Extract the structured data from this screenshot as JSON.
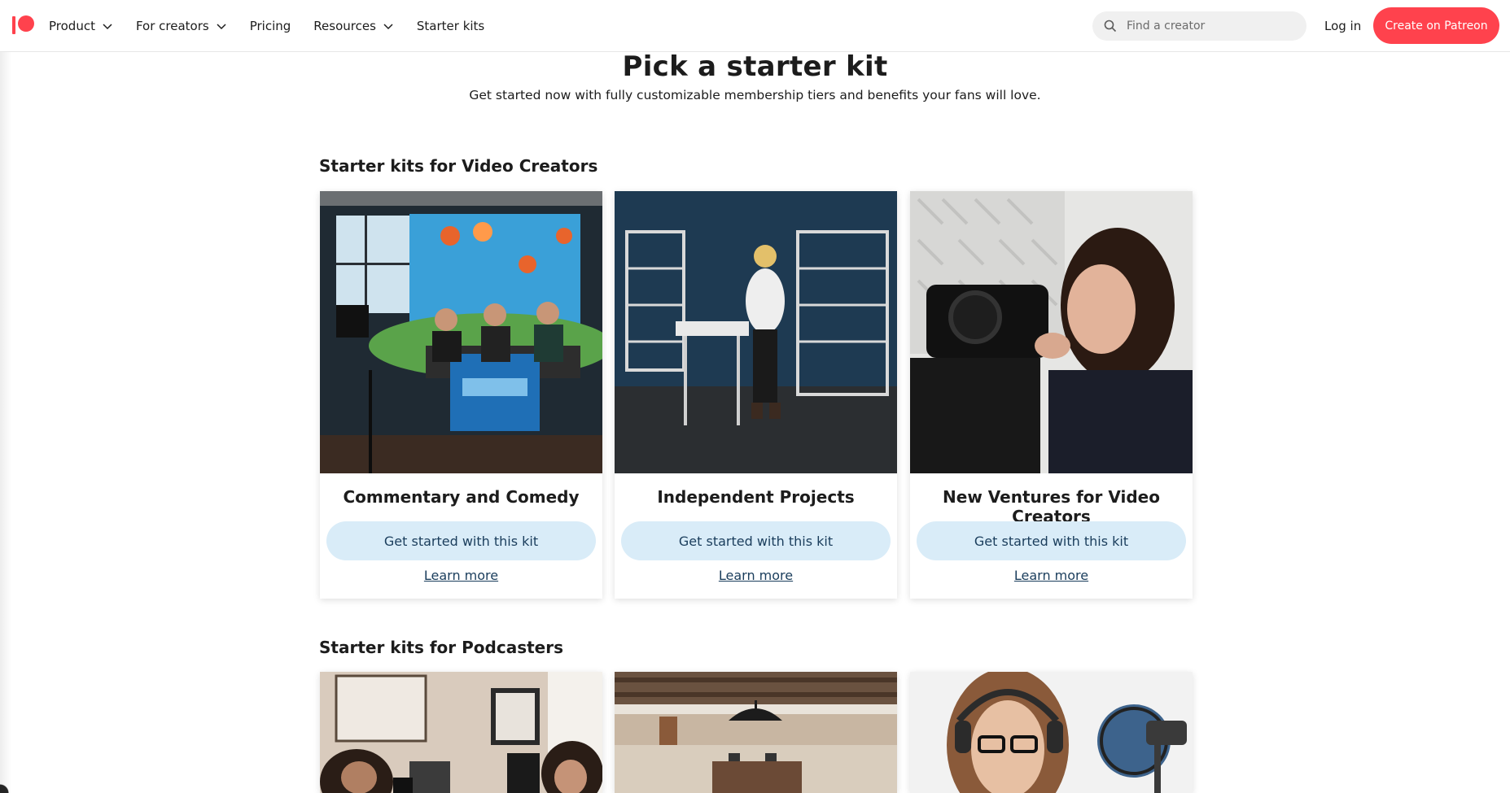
{
  "header": {
    "logo_name": "patreon-logo",
    "nav": [
      {
        "label": "Product",
        "dropdown": true
      },
      {
        "label": "For creators",
        "dropdown": true
      },
      {
        "label": "Pricing",
        "dropdown": false
      },
      {
        "label": "Resources",
        "dropdown": true
      },
      {
        "label": "Starter kits",
        "dropdown": false
      }
    ],
    "search_placeholder": "Find a creator",
    "login_label": "Log in",
    "create_label": "Create on Patreon"
  },
  "hero": {
    "title": "Pick a starter kit",
    "subtitle": "Get started now with fully customizable membership tiers and benefits your fans will love."
  },
  "sections": [
    {
      "title": "Starter kits for Video Creators",
      "cards": [
        {
          "title": "Commentary and Comedy",
          "button": "Get started with this kit",
          "link": "Learn more"
        },
        {
          "title": "Independent Projects",
          "button": "Get started with this kit",
          "link": "Learn more"
        },
        {
          "title": "New Ventures for Video Creators",
          "button": "Get started with this kit",
          "link": "Learn more"
        }
      ]
    },
    {
      "title": "Starter kits for Podcasters",
      "cards": [
        {
          "title": "",
          "button": "",
          "link": ""
        },
        {
          "title": "",
          "button": "",
          "link": ""
        },
        {
          "title": "",
          "button": "",
          "link": ""
        }
      ]
    }
  ],
  "colors": {
    "brand": "#ff424d",
    "button_bg": "#d9ecf8",
    "button_text": "#1a3d5c",
    "text": "#1c1c1c"
  }
}
